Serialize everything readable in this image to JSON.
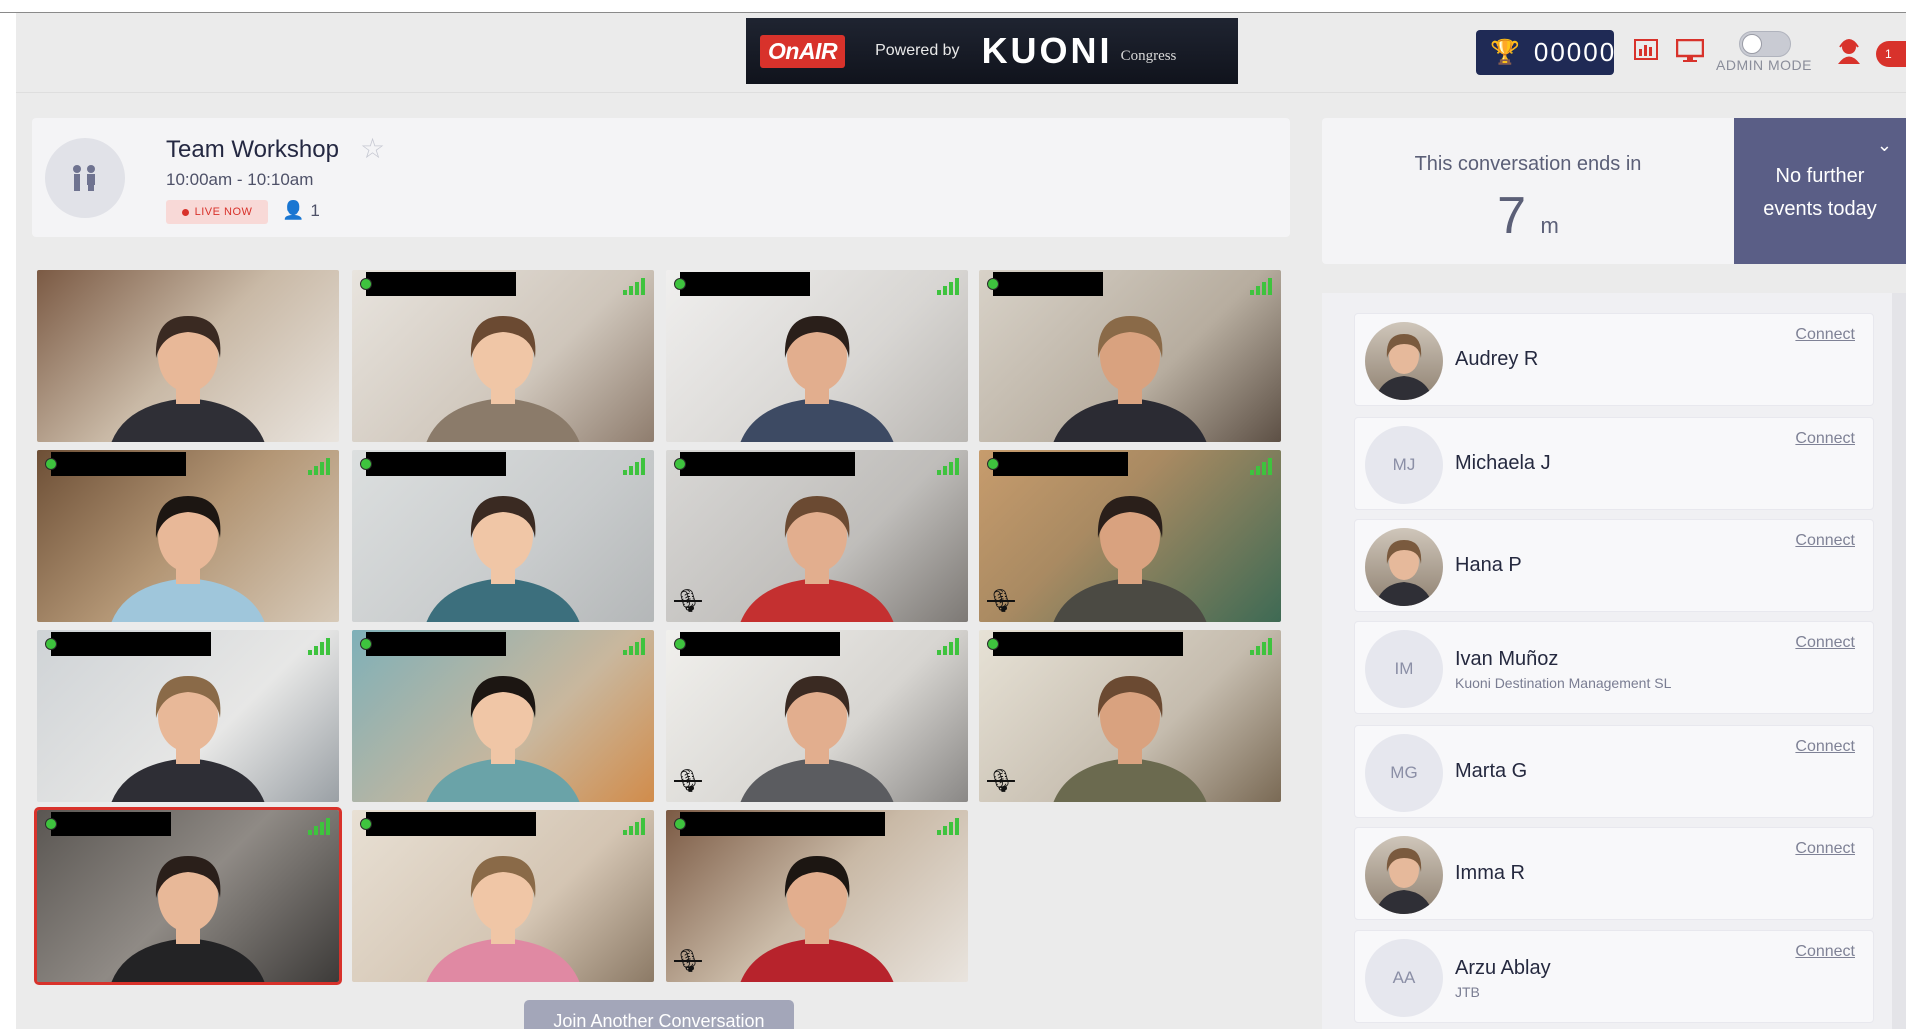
{
  "header": {
    "brand_onair": "OnAIR",
    "brand_powered": "Powered by",
    "brand_kuoni": "KUONI",
    "brand_congress": "Congress",
    "points": "00000",
    "admin_mode_label": "ADMIN MODE",
    "notification_count": "1",
    "icons": [
      "trophy-icon",
      "leaderboard-icon",
      "screen-icon",
      "toggle",
      "agent-icon"
    ]
  },
  "session": {
    "title": "Team Workshop",
    "time": "10:00am - 10:10am",
    "live_label": "LIVE NOW",
    "attendee_count": "1"
  },
  "countdown": {
    "label": "This conversation ends in",
    "value": "7",
    "unit": "m",
    "no_further": [
      "No further",
      "events today"
    ]
  },
  "video": {
    "tiles": 14,
    "join_label": "Join Another Conversation"
  },
  "attendees": [
    {
      "name": "Audrey R",
      "org": "",
      "initials": "",
      "photo": true,
      "connect": "Connect"
    },
    {
      "name": "Michaela J",
      "org": "",
      "initials": "MJ",
      "photo": false,
      "connect": "Connect"
    },
    {
      "name": "Hana P",
      "org": "",
      "initials": "",
      "photo": true,
      "connect": "Connect"
    },
    {
      "name": "Ivan Muñoz",
      "org": "Kuoni Destination Management SL",
      "initials": "IM",
      "photo": false,
      "connect": "Connect"
    },
    {
      "name": "Marta G",
      "org": "",
      "initials": "MG",
      "photo": false,
      "connect": "Connect"
    },
    {
      "name": "Imma R",
      "org": "",
      "initials": "",
      "photo": true,
      "connect": "Connect"
    },
    {
      "name": "Arzu Ablay",
      "org": "JTB",
      "initials": "AA",
      "photo": false,
      "connect": "Connect"
    }
  ],
  "colors": {
    "accent_red": "#d8322b",
    "navy": "#1f2a55",
    "panel_purple": "#5a5e86"
  }
}
